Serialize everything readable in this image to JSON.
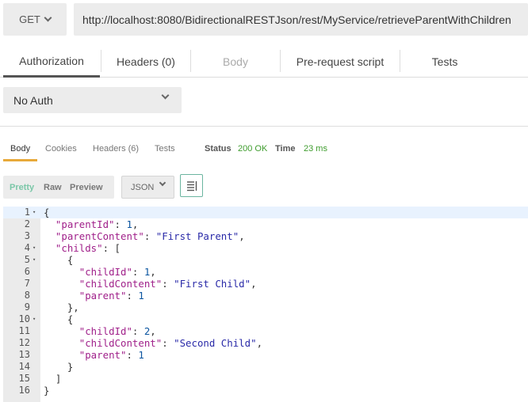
{
  "request": {
    "method": "GET",
    "url": "http://localhost:8080/BidirectionalRESTJson/rest/MyService/retrieveParentWithChildren"
  },
  "request_tabs": [
    "Authorization",
    "Headers (0)",
    "Body",
    "Pre-request script",
    "Tests"
  ],
  "auth": {
    "type": "No Auth"
  },
  "response_tabs": [
    "Body",
    "Cookies",
    "Headers (6)",
    "Tests"
  ],
  "status": {
    "label": "Status",
    "value": "200 OK",
    "time_label": "Time",
    "time_value": "23 ms"
  },
  "view": {
    "pretty": "Pretty",
    "raw": "Raw",
    "preview": "Preview",
    "format": "JSON"
  },
  "icons": {
    "method_dropdown": "chevron-down-icon",
    "auth_dropdown": "chevron-down-icon",
    "wrap": "wrap-lines-icon"
  },
  "colors": {
    "accent_green": "#3f9d2e",
    "pretty_active": "#7bc7a8",
    "body_tab_underline": "#e8a93a"
  },
  "code_lines": [
    {
      "n": "1",
      "fold": true,
      "parts": [
        [
          "p",
          "{"
        ]
      ]
    },
    {
      "n": "2",
      "fold": false,
      "parts": [
        [
          "p",
          "  "
        ],
        [
          "k",
          "\"parentId\""
        ],
        [
          "p",
          ": "
        ],
        [
          "n",
          "1"
        ],
        [
          "p",
          ","
        ]
      ]
    },
    {
      "n": "3",
      "fold": false,
      "parts": [
        [
          "p",
          "  "
        ],
        [
          "k",
          "\"parentContent\""
        ],
        [
          "p",
          ": "
        ],
        [
          "s",
          "\"First Parent\""
        ],
        [
          "p",
          ","
        ]
      ]
    },
    {
      "n": "4",
      "fold": true,
      "parts": [
        [
          "p",
          "  "
        ],
        [
          "k",
          "\"childs\""
        ],
        [
          "p",
          ": ["
        ]
      ]
    },
    {
      "n": "5",
      "fold": true,
      "parts": [
        [
          "p",
          "    {"
        ]
      ]
    },
    {
      "n": "6",
      "fold": false,
      "parts": [
        [
          "p",
          "      "
        ],
        [
          "k",
          "\"childId\""
        ],
        [
          "p",
          ": "
        ],
        [
          "n",
          "1"
        ],
        [
          "p",
          ","
        ]
      ]
    },
    {
      "n": "7",
      "fold": false,
      "parts": [
        [
          "p",
          "      "
        ],
        [
          "k",
          "\"childContent\""
        ],
        [
          "p",
          ": "
        ],
        [
          "s",
          "\"First Child\""
        ],
        [
          "p",
          ","
        ]
      ]
    },
    {
      "n": "8",
      "fold": false,
      "parts": [
        [
          "p",
          "      "
        ],
        [
          "k",
          "\"parent\""
        ],
        [
          "p",
          ": "
        ],
        [
          "n",
          "1"
        ]
      ]
    },
    {
      "n": "9",
      "fold": false,
      "parts": [
        [
          "p",
          "    },"
        ]
      ]
    },
    {
      "n": "10",
      "fold": true,
      "parts": [
        [
          "p",
          "    {"
        ]
      ]
    },
    {
      "n": "11",
      "fold": false,
      "parts": [
        [
          "p",
          "      "
        ],
        [
          "k",
          "\"childId\""
        ],
        [
          "p",
          ": "
        ],
        [
          "n",
          "2"
        ],
        [
          "p",
          ","
        ]
      ]
    },
    {
      "n": "12",
      "fold": false,
      "parts": [
        [
          "p",
          "      "
        ],
        [
          "k",
          "\"childContent\""
        ],
        [
          "p",
          ": "
        ],
        [
          "s",
          "\"Second Child\""
        ],
        [
          "p",
          ","
        ]
      ]
    },
    {
      "n": "13",
      "fold": false,
      "parts": [
        [
          "p",
          "      "
        ],
        [
          "k",
          "\"parent\""
        ],
        [
          "p",
          ": "
        ],
        [
          "n",
          "1"
        ]
      ]
    },
    {
      "n": "14",
      "fold": false,
      "parts": [
        [
          "p",
          "    }"
        ]
      ]
    },
    {
      "n": "15",
      "fold": false,
      "parts": [
        [
          "p",
          "  ]"
        ]
      ]
    },
    {
      "n": "16",
      "fold": false,
      "parts": [
        [
          "p",
          "}"
        ]
      ]
    }
  ]
}
